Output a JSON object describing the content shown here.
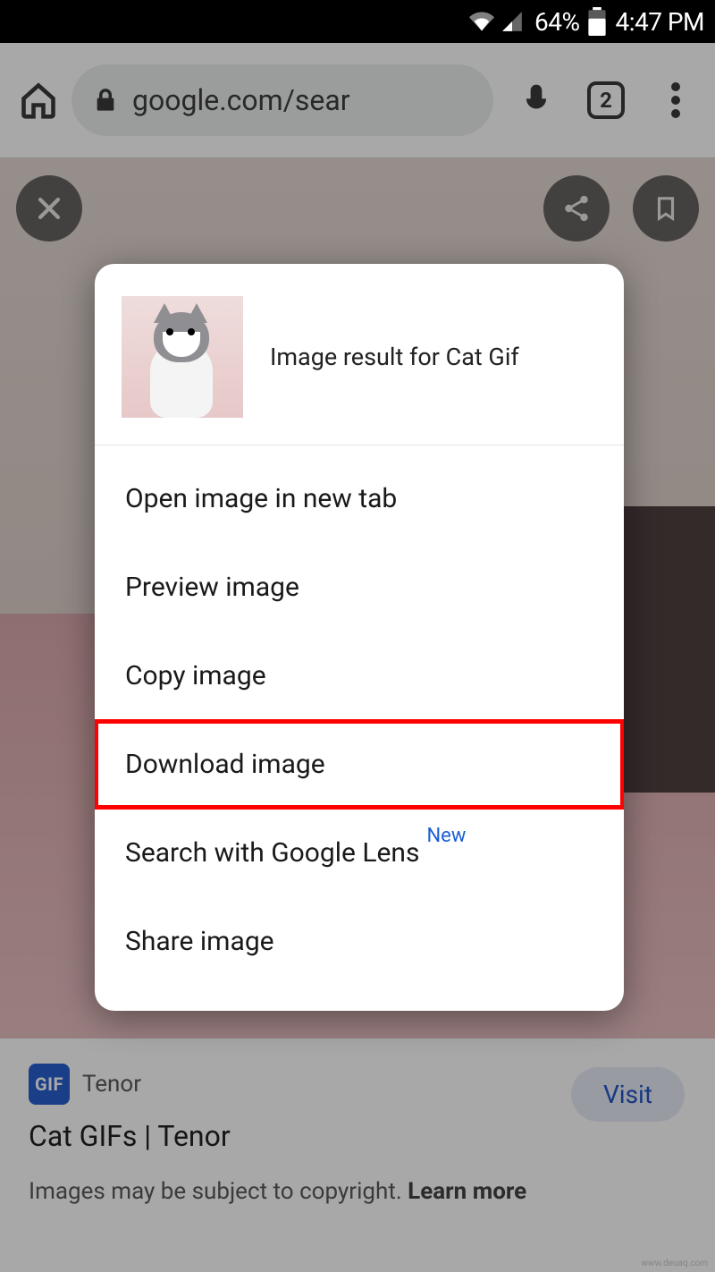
{
  "status_bar": {
    "battery_percent": "64%",
    "time": "4:47 PM"
  },
  "chrome": {
    "url": "google.com/sear",
    "tab_count": "2"
  },
  "context_menu": {
    "title": "Image result for Cat Gif",
    "items": {
      "open_new_tab": "Open image in new tab",
      "preview": "Preview image",
      "copy": "Copy image",
      "download": "Download image",
      "search_lens": "Search with Google Lens",
      "search_lens_badge": "New",
      "share": "Share image"
    }
  },
  "source_info": {
    "badge": "GIF",
    "source_name": "Tenor",
    "title": "Cat GIFs | Tenor",
    "visit_label": "Visit",
    "copyright_text": "Images may be subject to copyright. ",
    "learn_more": "Learn more"
  },
  "watermark": "www.deuaq.com"
}
